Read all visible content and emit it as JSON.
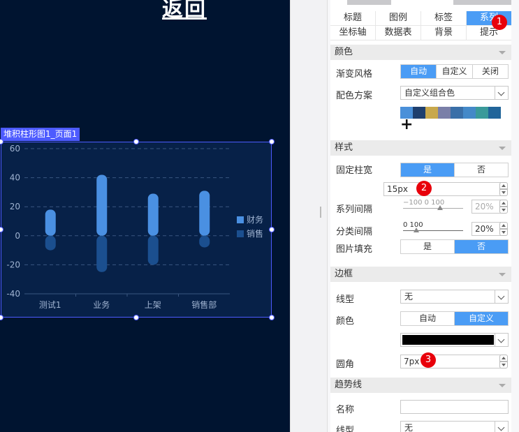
{
  "canvas": {
    "heading": "返回",
    "chart_tag": "堆积柱形图1_页面1"
  },
  "chart_data": {
    "type": "bar",
    "stacked": true,
    "categories": [
      "测试1",
      "业务",
      "上架",
      "销售部"
    ],
    "series": [
      {
        "name": "财务",
        "values": [
          18,
          42,
          29,
          31
        ],
        "color": "#4a90e2"
      },
      {
        "name": "销售",
        "values": [
          -10,
          -25,
          -20,
          -8
        ],
        "color": "#1b4f8f"
      }
    ],
    "yticks": [
      "60",
      "40",
      "20",
      "0",
      "-20",
      "-40"
    ],
    "ylim": [
      -40,
      60
    ],
    "grid": true,
    "legend": "right"
  },
  "panel": {
    "tabs_row1": [
      "标题",
      "图例",
      "标签",
      "系列"
    ],
    "tabs_row2": [
      "坐标轴",
      "数据表",
      "背景",
      "提示"
    ],
    "active_tab": "系列",
    "badges": [
      "1",
      "2",
      "3"
    ],
    "sections": {
      "color": "颜色",
      "style": "样式",
      "border": "边框",
      "trend": "趋势线"
    },
    "gradient": {
      "label": "渐变风格",
      "options": [
        "自动",
        "自定义",
        "关闭"
      ],
      "selected": "自动"
    },
    "scheme": {
      "label": "配色方案",
      "value": "自定义组合色"
    },
    "swatch_colors": [
      "#4a90d9",
      "#1e3f6e",
      "#c8a84c",
      "#7a7fa8",
      "#3a6fa8",
      "#4489c8",
      "#3a9a9a",
      "#21659a"
    ],
    "add_symbol": "+",
    "fixed_width": {
      "label": "固定柱宽",
      "options": [
        "是",
        "否"
      ],
      "selected": "是",
      "value": "15px"
    },
    "series_gap": {
      "label": "系列间隔",
      "ticks": "−100     0     100",
      "value": "20%"
    },
    "category_gap": {
      "label": "分类间隔",
      "ticks": "0                    100",
      "value": "20%"
    },
    "image_fill": {
      "label": "图片填充",
      "options": [
        "是",
        "否"
      ],
      "selected": "否"
    },
    "line_type": {
      "label": "线型",
      "value": "无"
    },
    "border_color": {
      "label": "颜色",
      "options": [
        "自动",
        "自定义"
      ],
      "selected": "自定义",
      "swatch": "#000000"
    },
    "radius": {
      "label": "圆角",
      "value": "7px"
    },
    "trend_name": {
      "label": "名称",
      "value": ""
    },
    "trend_line": {
      "label": "线型",
      "value": "无"
    }
  }
}
